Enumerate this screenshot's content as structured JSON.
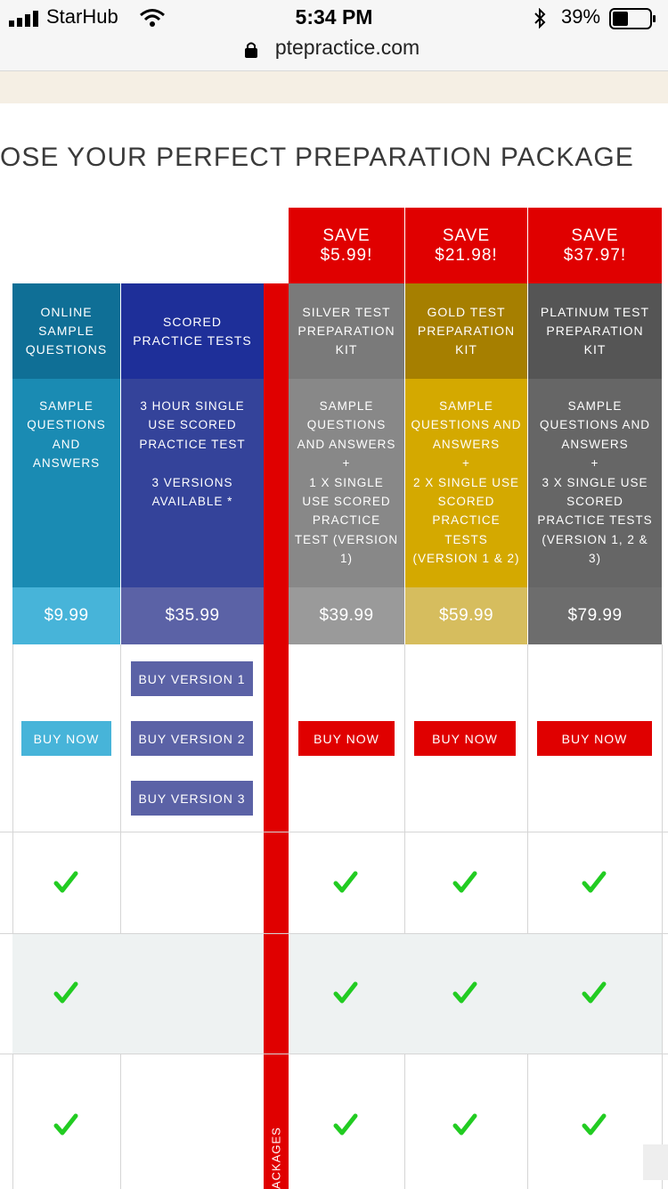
{
  "status_bar": {
    "carrier": "StarHub",
    "time": "5:34 PM",
    "battery": "39%"
  },
  "browser": {
    "url": "ptepractice.com"
  },
  "page": {
    "heading": "OSE YOUR PERFECT PREPARATION PACKAGE",
    "vertical_label": "ACKAGES"
  },
  "colors": {
    "red": "#e00000",
    "teal": "#0f6f96",
    "navy": "#1e2f99",
    "silver": "#7a7a7a",
    "gold": "#a67f00",
    "platinum": "#555555"
  },
  "savings": [
    "SAVE\n$5.99!",
    "SAVE\n$21.98!",
    "SAVE\n$37.97!"
  ],
  "packages": [
    {
      "name": "ONLINE SAMPLE QUESTIONS",
      "desc": "SAMPLE QUESTIONS AND ANSWERS",
      "price": "$9.99"
    },
    {
      "name": "SCORED PRACTICE TESTS",
      "desc": "3 HOUR SINGLE USE SCORED PRACTICE TEST\n\n3 VERSIONS AVAILABLE *",
      "price": "$35.99"
    },
    {
      "name": "SILVER TEST PREPARATION KIT",
      "desc": "SAMPLE QUESTIONS AND ANSWERS\n+\n1 X SINGLE USE SCORED PRACTICE TEST (VERSION 1)",
      "price": "$39.99"
    },
    {
      "name": "GOLD TEST PREPARATION KIT",
      "desc": "SAMPLE QUESTIONS AND ANSWERS\n+\n2 X SINGLE USE SCORED PRACTICE TESTS (VERSION 1 & 2)",
      "price": "$59.99"
    },
    {
      "name": "PLATINUM TEST PREPARATION KIT",
      "desc": "SAMPLE QUESTIONS AND ANSWERS\n+\n3 X SINGLE USE SCORED PRACTICE TESTS (VERSION 1, 2 & 3)",
      "price": "$79.99"
    }
  ],
  "buttons": {
    "buy_now": "BUY NOW",
    "version1": "BUY VERSION 1",
    "version2": "BUY VERSION 2",
    "version3": "BUY VERSION 3"
  }
}
